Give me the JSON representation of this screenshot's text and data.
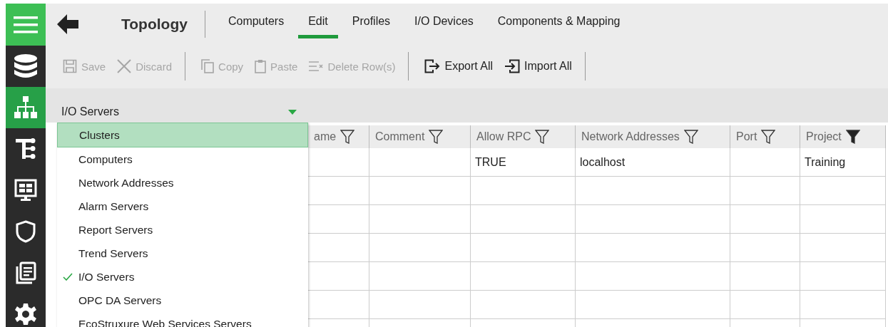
{
  "sidebar": {
    "items": [
      {
        "selected": false
      },
      {
        "selected": true
      },
      {
        "selected": false
      },
      {
        "selected": false
      },
      {
        "selected": false
      },
      {
        "selected": false
      },
      {
        "selected": false
      }
    ]
  },
  "header": {
    "title": "Topology",
    "tabs": [
      {
        "label": "Computers",
        "selected": false
      },
      {
        "label": "Edit",
        "selected": true
      },
      {
        "label": "Profiles",
        "selected": false
      },
      {
        "label": "I/O Devices",
        "selected": false
      },
      {
        "label": "Components & Mapping",
        "selected": false
      }
    ]
  },
  "toolbar": {
    "groups": [
      [
        {
          "label": "Save",
          "disabled": true
        },
        {
          "label": "Discard",
          "disabled": true
        }
      ],
      [
        {
          "label": "Copy",
          "disabled": true
        },
        {
          "label": "Paste",
          "disabled": true
        },
        {
          "label": "Delete Row(s)",
          "disabled": true
        }
      ],
      [
        {
          "label": "Export All",
          "disabled": false
        },
        {
          "label": "Import All",
          "disabled": false
        }
      ]
    ]
  },
  "view_select": {
    "value": "I/O Servers",
    "options": [
      {
        "label": "Clusters",
        "selected": false,
        "highlighted": true
      },
      {
        "label": "Computers",
        "selected": false,
        "highlighted": false
      },
      {
        "label": "Network Addresses",
        "selected": false,
        "highlighted": false
      },
      {
        "label": "Alarm Servers",
        "selected": false,
        "highlighted": false
      },
      {
        "label": "Report Servers",
        "selected": false,
        "highlighted": false
      },
      {
        "label": "Trend Servers",
        "selected": false,
        "highlighted": false
      },
      {
        "label": "I/O Servers",
        "selected": true,
        "highlighted": false
      },
      {
        "label": "OPC DA Servers",
        "selected": false,
        "highlighted": false
      },
      {
        "label": "EcoStruxure Web Services Servers",
        "selected": false,
        "highlighted": false
      }
    ]
  },
  "table": {
    "columns": [
      {
        "label": "ame",
        "filtered": false
      },
      {
        "label": "Comment",
        "filtered": false
      },
      {
        "label": "Allow RPC",
        "filtered": false
      },
      {
        "label": "Network Addresses",
        "filtered": false
      },
      {
        "label": "Port",
        "filtered": false
      },
      {
        "label": "Project",
        "filtered": true
      }
    ],
    "rows": [
      {
        "cells": [
          null,
          null,
          "TRUE",
          "localhost",
          null,
          "Training"
        ]
      }
    ]
  }
}
